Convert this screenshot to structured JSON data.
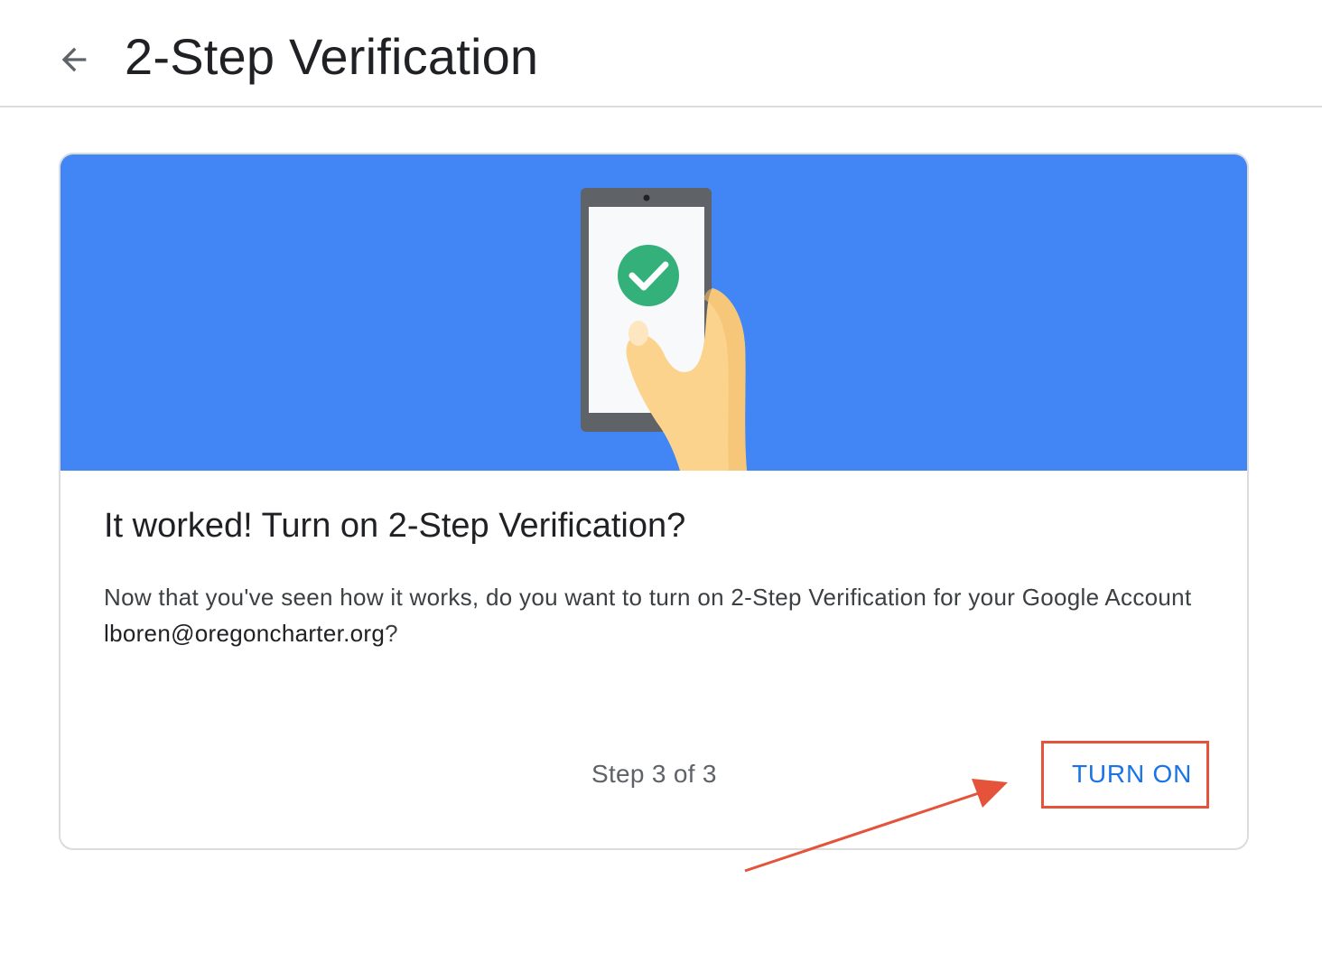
{
  "header": {
    "title": "2-Step Verification",
    "back_icon": "arrow-back-icon"
  },
  "hero": {
    "illustration": "phone-in-hand-with-check-illustration",
    "background_color": "#4285f4",
    "check_color": "#34b07a"
  },
  "card": {
    "heading": "It worked! Turn on 2-Step Verification?",
    "body_prefix": "Now that you've seen how it works, do you want to turn on 2-Step Verification for your Google Account",
    "email": "lboren@oregoncharter.org",
    "body_suffix": "?",
    "step_label": "Step 3 of 3",
    "turn_on_label": "TURN ON"
  },
  "annotation": {
    "color": "#e4533a"
  }
}
